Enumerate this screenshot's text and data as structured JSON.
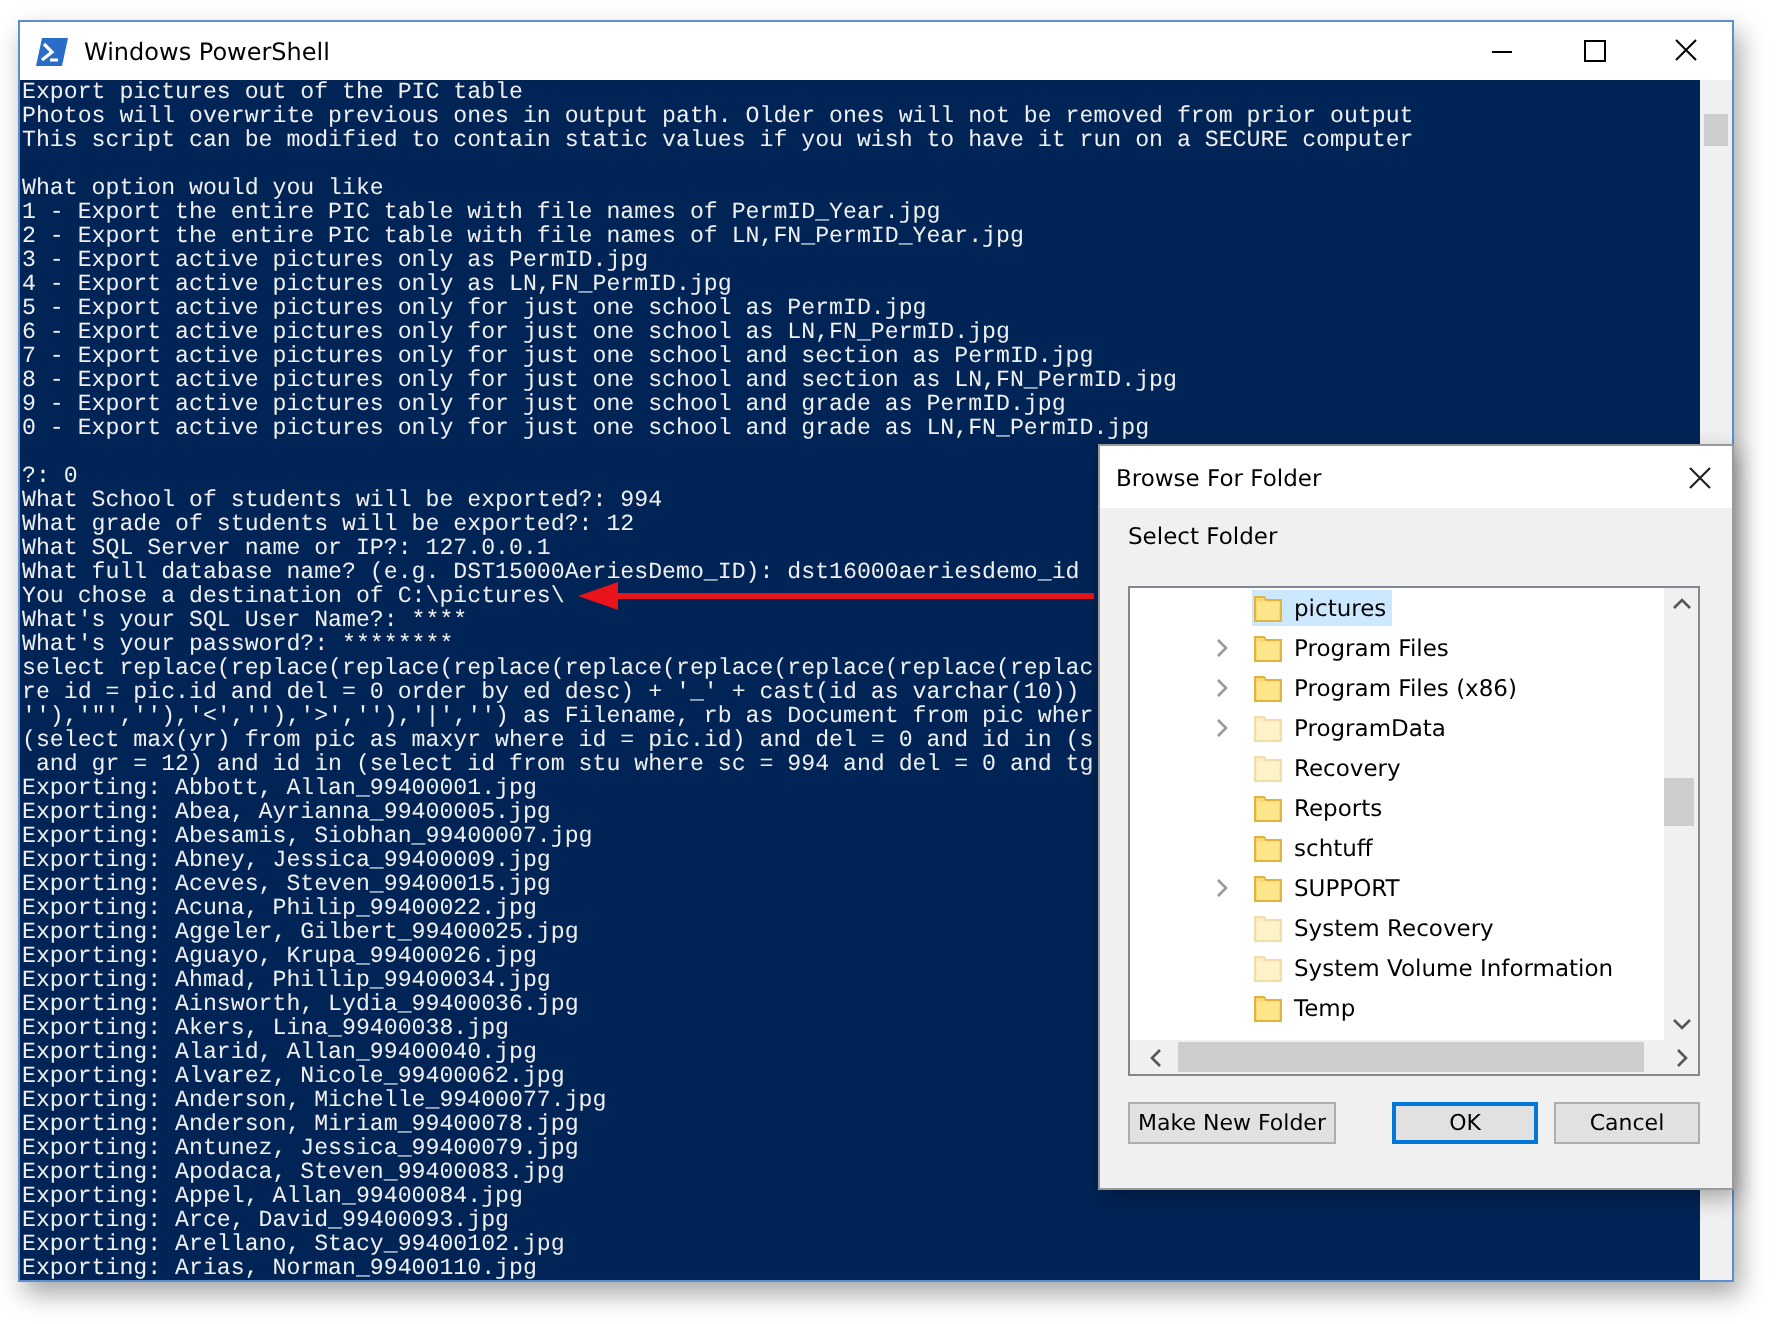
{
  "window": {
    "title": "Windows PowerShell"
  },
  "console_blocks": [
    [
      "Export pictures out of the PIC table",
      "Photos will overwrite previous ones in output path. Older ones will not be removed from prior output",
      "This script can be modified to contain static values if you wish to have it run on a SECURE computer"
    ],
    [
      "What option would you like",
      "1 - Export the entire PIC table with file names of PermID_Year.jpg",
      "2 - Export the entire PIC table with file names of LN,FN_PermID_Year.jpg",
      "3 - Export active pictures only as PermID.jpg",
      "4 - Export active pictures only as LN,FN_PermID.jpg",
      "5 - Export active pictures only for just one school as PermID.jpg",
      "6 - Export active pictures only for just one school as LN,FN_PermID.jpg",
      "7 - Export active pictures only for just one school and section as PermID.jpg",
      "8 - Export active pictures only for just one school and section as LN,FN_PermID.jpg",
      "9 - Export active pictures only for just one school and grade as PermID.jpg",
      "0 - Export active pictures only for just one school and grade as LN,FN_PermID.jpg"
    ],
    [
      "?: 0",
      "What School of students will be exported?: 994",
      "What grade of students will be exported?: 12",
      "What SQL Server name or IP?: 127.0.0.1",
      "What full database name? (e.g. DST15000AeriesDemo_ID): dst16000aeriesdemo_id",
      "You chose a destination of C:\\pictures\\",
      "What's your SQL User Name?: ****",
      "What's your password?: ********",
      "select replace(replace(replace(replace(replace(replace(replace(replace(replac",
      "re id = pic.id and del = 0 order by ed desc) + '_' + cast(id as varchar(10))",
      "''),'\"',''),'<',''),'>',''),'|','') as Filename, rb as Document from pic wher",
      "(select max(yr) from pic as maxyr where id = pic.id) and del = 0 and id in (s",
      " and gr = 12) and id in (select id from stu where sc = 994 and del = 0 and tg",
      "Exporting: Abbott, Allan_99400001.jpg",
      "Exporting: Abea, Ayrianna_99400005.jpg",
      "Exporting: Abesamis, Siobhan_99400007.jpg",
      "Exporting: Abney, Jessica_99400009.jpg",
      "Exporting: Aceves, Steven_99400015.jpg",
      "Exporting: Acuna, Philip_99400022.jpg",
      "Exporting: Aggeler, Gilbert_99400025.jpg",
      "Exporting: Aguayo, Krupa_99400026.jpg",
      "Exporting: Ahmad, Phillip_99400034.jpg",
      "Exporting: Ainsworth, Lydia_99400036.jpg",
      "Exporting: Akers, Lina_99400038.jpg",
      "Exporting: Alarid, Allan_99400040.jpg",
      "Exporting: Alvarez, Nicole_99400062.jpg",
      "Exporting: Anderson, Michelle_99400077.jpg",
      "Exporting: Anderson, Miriam_99400078.jpg",
      "Exporting: Antunez, Jessica_99400079.jpg",
      "Exporting: Apodaca, Steven_99400083.jpg",
      "Exporting: Appel, Allan_99400084.jpg",
      "Exporting: Arce, David_99400093.jpg",
      "Exporting: Arellano, Stacy_99400102.jpg",
      "Exporting: Arias, Norman_99400110.jpg"
    ]
  ],
  "dialog": {
    "title": "Browse For Folder",
    "prompt": "Select Folder",
    "folders": [
      {
        "name": "pictures",
        "selected": true,
        "expandable": false,
        "hidden": false
      },
      {
        "name": "Program Files",
        "selected": false,
        "expandable": true,
        "hidden": false
      },
      {
        "name": "Program Files (x86)",
        "selected": false,
        "expandable": true,
        "hidden": false
      },
      {
        "name": "ProgramData",
        "selected": false,
        "expandable": true,
        "hidden": true
      },
      {
        "name": "Recovery",
        "selected": false,
        "expandable": false,
        "hidden": true
      },
      {
        "name": "Reports",
        "selected": false,
        "expandable": false,
        "hidden": false
      },
      {
        "name": "schtuff",
        "selected": false,
        "expandable": false,
        "hidden": false
      },
      {
        "name": "SUPPORT",
        "selected": false,
        "expandable": true,
        "hidden": false
      },
      {
        "name": "System Recovery",
        "selected": false,
        "expandable": false,
        "hidden": true
      },
      {
        "name": "System Volume Information",
        "selected": false,
        "expandable": false,
        "hidden": true
      },
      {
        "name": "Temp",
        "selected": false,
        "expandable": false,
        "hidden": false
      }
    ],
    "buttons": [
      {
        "label": "Make New Folder",
        "default": false
      },
      {
        "label": "OK",
        "default": true
      },
      {
        "label": "Cancel",
        "default": false
      }
    ]
  }
}
